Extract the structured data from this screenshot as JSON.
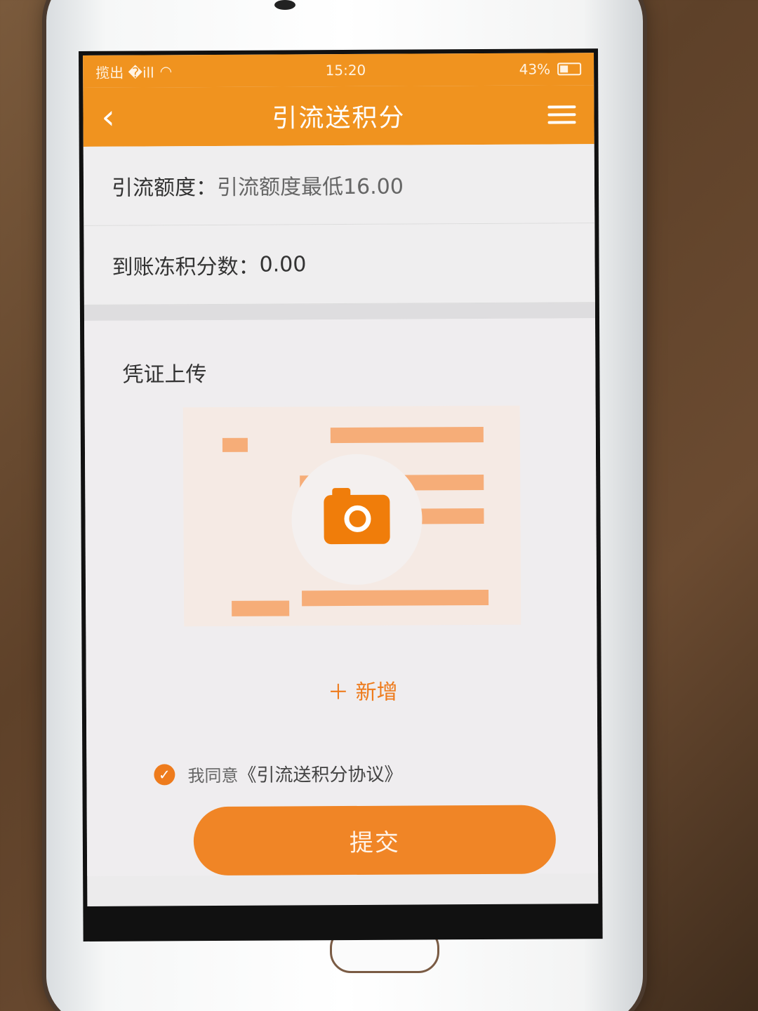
{
  "status_bar": {
    "carrier": "揽出 �ill",
    "time": "15:20",
    "battery": "43%"
  },
  "header": {
    "title": "引流送积分"
  },
  "form": {
    "quota_label": "引流额度：",
    "quota_placeholder": "引流额度最低16.00",
    "points_label": "到账冻积分数：",
    "points_value": "0.00"
  },
  "upload": {
    "title": "凭证上传",
    "add_label": "＋ 新增"
  },
  "agreement": {
    "prefix": "我同意",
    "link": "《引流送积分协议》",
    "checked": true
  },
  "submit_label": "提交",
  "colors": {
    "accent": "#f0931f",
    "button": "#f08526"
  }
}
